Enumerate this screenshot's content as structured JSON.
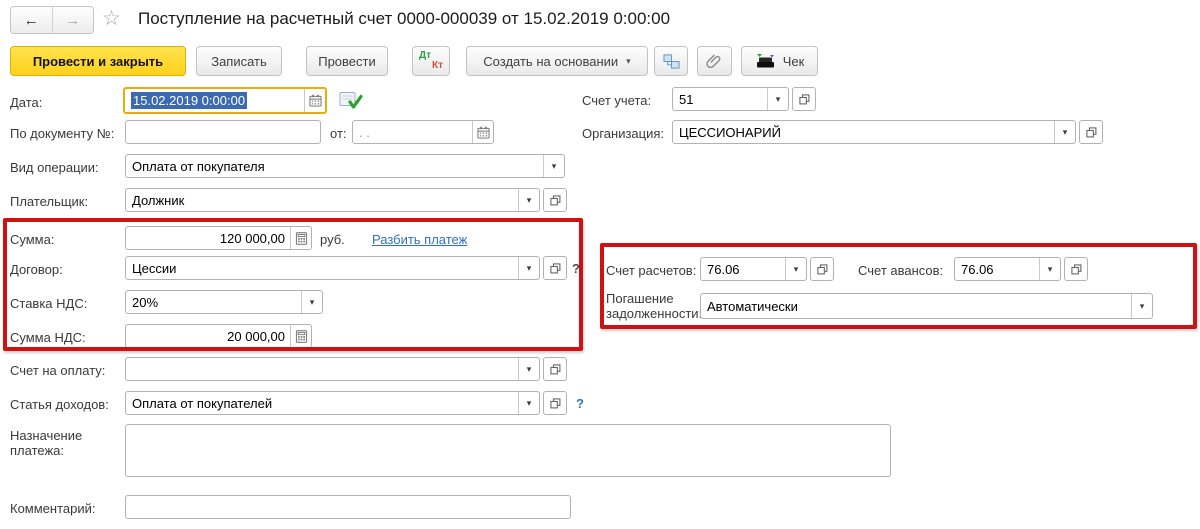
{
  "window": {
    "title": "Поступление на расчетный счет 0000-000039 от 15.02.2019 0:00:00"
  },
  "icons": {
    "back": "←",
    "forward": "→",
    "favorite_star": "☆",
    "dropdown": "▾",
    "help": "?"
  },
  "toolbar": {
    "post_and_close": "Провести и закрыть",
    "write": "Записать",
    "post": "Провести",
    "dt": "Дт",
    "kt": "Кт",
    "create_based_on": "Создать на основании",
    "receipt": "Чек"
  },
  "fields": {
    "date": {
      "label": "Дата:",
      "value": "15.02.2019 0:00:00"
    },
    "by_document": {
      "label": "По документу №:",
      "value": "",
      "from_label": "от:",
      "from_placeholder": ". ."
    },
    "operation_kind": {
      "label": "Вид операции:",
      "value": "Оплата от покупателя"
    },
    "payer": {
      "label": "Плательщик:",
      "value": "Должник"
    },
    "amount": {
      "label": "Сумма:",
      "value": "120 000,00",
      "currency": "руб.",
      "split_payment_link": "Разбить платеж"
    },
    "contract": {
      "label": "Договор:",
      "value": "Цессии"
    },
    "vat_rate": {
      "label": "Ставка НДС:",
      "value": "20%"
    },
    "vat_amount": {
      "label": "Сумма НДС:",
      "value": "20 000,00"
    },
    "payment_invoice": {
      "label": "Счет на оплату:",
      "value": ""
    },
    "income_item": {
      "label": "Статья доходов:",
      "value": "Оплата от покупателей"
    },
    "payment_purpose": {
      "label": "Назначение платежа:",
      "value": ""
    },
    "comment": {
      "label": "Комментарий:",
      "value": ""
    },
    "accounting_account": {
      "label": "Счет учета:",
      "value": "51"
    },
    "organization": {
      "label": "Организация:",
      "value": "ЦЕССИОНАРИЙ"
    },
    "settlement_account": {
      "label": "Счет расчетов:",
      "value": "76.06"
    },
    "advance_account": {
      "label": "Счет авансов:",
      "value": "76.06"
    },
    "debt_repayment": {
      "label": "Погашение задолженности:",
      "value": "Автоматически"
    }
  },
  "colors": {
    "accent_yellow": "#ffd11a",
    "highlight_red": "#d01111",
    "link_blue": "#2f71c8",
    "selection_blue": "#3b6ab2",
    "focus_border": "#e5ae0c"
  }
}
